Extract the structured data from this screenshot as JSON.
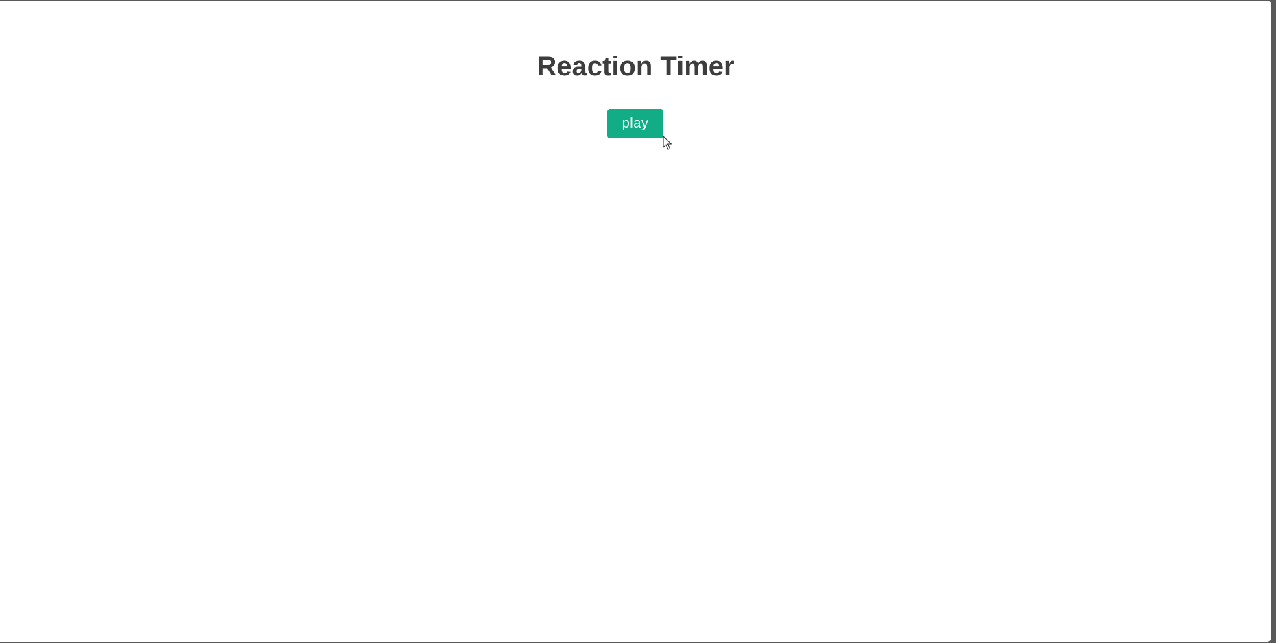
{
  "app": {
    "title": "Reaction Timer"
  },
  "controls": {
    "play_label": "play"
  },
  "colors": {
    "accent": "#12ad87",
    "title_text": "#3d3d3d",
    "background": "#ffffff"
  },
  "icons": {
    "cursor": "mouse-pointer-icon"
  }
}
